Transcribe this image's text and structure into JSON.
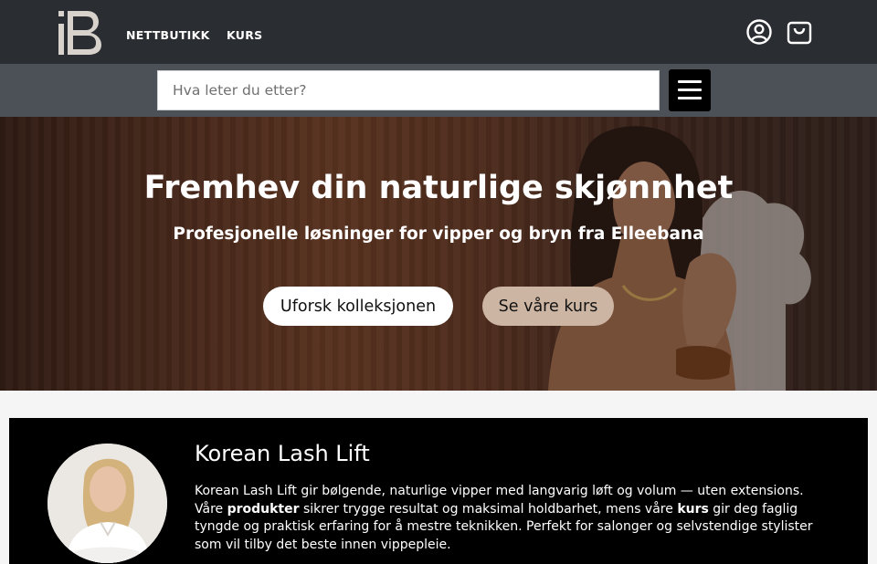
{
  "header": {
    "logo_icon": "ib-monogram-logo",
    "nav": [
      {
        "label": "NETTBUTIKK"
      },
      {
        "label": "KURS"
      }
    ],
    "icons": {
      "account": "user-circle-icon",
      "cart": "shopping-bag-icon"
    }
  },
  "search": {
    "placeholder": "Hva leter du etter?",
    "menu_icon": "hamburger-menu-icon"
  },
  "hero": {
    "title": "Fremhev din naturlige skjønnhet",
    "subtitle": "Profesjonelle løsninger for vipper og bryn fra Elleebana",
    "primary_button": "Uforsk kolleksjonen",
    "secondary_button": "Se våre kurs"
  },
  "feature": {
    "title": "Korean Lash Lift",
    "text_1": "Korean Lash Lift gir bølgende, naturlige vipper med langvarig løft og volum — uten extensions. Våre ",
    "link_products": "produkter",
    "text_2": " sikrer trygge resultat og maksimal holdbarhet, mens våre ",
    "link_courses": "kurs",
    "text_3": " gir deg faglig tyngde og praktisk erfaring for å mestre teknikken. Perfekt for salonger og selvstendige stylister som vil tilby det beste innen vippepleie."
  },
  "colors": {
    "topbar": "#2a2d31",
    "searchbar": "#4b5156",
    "accent_button": "#cdb5a3",
    "card": "#000000"
  }
}
